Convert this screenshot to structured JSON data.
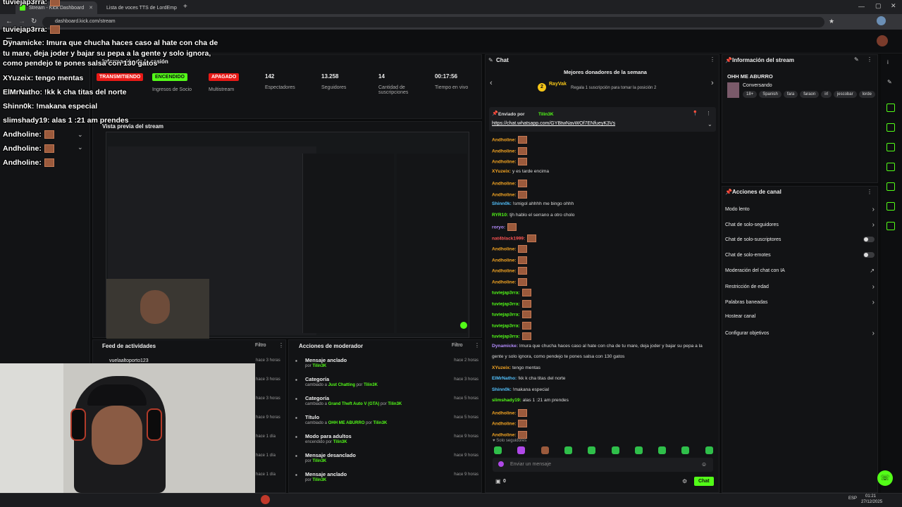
{
  "browser": {
    "tabs": [
      {
        "label": "Stream - Kick Dashboard"
      },
      {
        "label": "Lista de voces TTS de LordEmp"
      }
    ],
    "url": "dashboard.kick.com/stream"
  },
  "overlay": {
    "lines": [
      {
        "text": "tuviejap3rra:",
        "emote": true
      },
      {
        "text": "tuviejap3rra:",
        "emote": true
      },
      {
        "text": "Dynamicke: Imura que chucha haces caso al hate con cha de",
        "emote": false
      },
      {
        "text": "tu mare, deja joder y bajar su pepa a la gente y solo ignora,",
        "emote": false
      },
      {
        "text": "como pendejo te pones salsa con 130 gatos",
        "emote": false
      },
      {
        "text": "XYuzeix: tengo mentas",
        "emote": false
      },
      {
        "text": "ElMrNatho: !kk k cha titas del norte",
        "emote": false
      },
      {
        "text": "Shinn0k: !makana especial",
        "emote": false
      },
      {
        "text": "slimshady19: alas 1 :21 am prendes",
        "emote": false
      },
      {
        "text": "Andholine:",
        "emote": true
      },
      {
        "text": "Andholine:",
        "emote": true
      },
      {
        "text": "Andholine:",
        "emote": true
      }
    ]
  },
  "stream_info_header": "Información de la sesión",
  "stats": [
    {
      "badge": "TRANSMITIENDO",
      "label": "",
      "color": "#e91916"
    },
    {
      "badge": "ENCENDIDO",
      "label": "Ingresos de Socio",
      "color": "#53fc18"
    },
    {
      "badge": "APAGADO",
      "label": "Multistream",
      "color": "#e91916"
    },
    {
      "value": "142",
      "label": "Espectadores"
    },
    {
      "value": "13.258",
      "label": "Seguidores"
    },
    {
      "value": "14",
      "label": "Cantidad de suscripciones"
    },
    {
      "value": "00:17:56",
      "label": "Tiempo en vivo"
    }
  ],
  "preview_title": "Vista previa del stream",
  "activity": {
    "title": "Feed de actividades",
    "filter": "Filtro",
    "items": [
      {
        "user": "vuelaaltoporto123",
        "time": "hace 3 horas"
      },
      {
        "user": "",
        "time": "hace 3 horas"
      },
      {
        "user": "",
        "time": "hace 3 horas"
      },
      {
        "user": "",
        "time": "hace 9 horas"
      },
      {
        "user": "",
        "time": "hace 1 día"
      },
      {
        "user": "",
        "time": "hace 1 día"
      },
      {
        "user": "",
        "time": "hace 1 día"
      }
    ]
  },
  "moderator": {
    "title": "Acciones de moderador",
    "filter": "Filtro",
    "items": [
      {
        "title": "Mensaje anclado",
        "pre": "por",
        "hl": "Tilin3K",
        "mid": "",
        "by": "",
        "time": "hace 2 horas",
        "icon": "pin-icon"
      },
      {
        "title": "Categoría",
        "pre": "cambiado a",
        "hl": "Just Chatting",
        "mid": "por",
        "by": "Tilin3K",
        "time": "hace 3 horas",
        "icon": "category-icon"
      },
      {
        "title": "Categoría",
        "pre": "cambiado a",
        "hl": "Grand Theft Auto V (GTA)",
        "mid": "por",
        "by": "Tilin3K",
        "time": "hace 5 horas",
        "icon": "category-icon"
      },
      {
        "title": "Título",
        "pre": "cambiado a",
        "hl": "OHH ME ABURRO",
        "mid": "por",
        "by": "Tilin3K",
        "time": "hace 5 horas",
        "icon": "title-icon"
      },
      {
        "title": "Modo para adultos",
        "pre": "encendido por",
        "hl": "Tilin3K",
        "mid": "",
        "by": "",
        "time": "hace 9 horas",
        "icon": "adult-icon"
      },
      {
        "title": "Mensaje desanclado",
        "pre": "por",
        "hl": "Tilin3K",
        "mid": "",
        "by": "",
        "time": "hace 9 horas",
        "icon": "unpin-icon"
      },
      {
        "title": "Mensaje anclado",
        "pre": "por",
        "hl": "Tilin3K",
        "mid": "",
        "by": "",
        "time": "hace 9 horas",
        "icon": "pin-icon"
      }
    ]
  },
  "chat": {
    "title": "Chat",
    "donors_title": "Mejores donadores de la semana",
    "top_donor": "RayVak",
    "top_donor_rank": "2",
    "donor_cta": "Regala 1 suscripción para tomar la posición 2",
    "pinned_by_label": "Enviado por",
    "pinned_by": "Tilin3K",
    "pinned_link": "https://chat.whatsapp.com/GYBtwNavWOf7ENfueyK3Vs",
    "messages": [
      {
        "user": "Andholine:",
        "text": "",
        "emote": true,
        "color": "#f5a623"
      },
      {
        "user": "Andholine:",
        "text": "",
        "emote": true,
        "color": "#f5a623"
      },
      {
        "user": "Andholine:",
        "text": "",
        "emote": true,
        "color": "#f5a623"
      },
      {
        "user": "XYuzeix:",
        "text": "y es tarde encima",
        "emote": false,
        "color": "#f5a623"
      },
      {
        "user": "Andholine:",
        "text": "",
        "emote": true,
        "color": "#f5a623"
      },
      {
        "user": "Andholine:",
        "text": "",
        "emote": true,
        "color": "#f5a623"
      },
      {
        "user": "Shinn0k:",
        "text": "!smigol ahhhh me bingo ohhh",
        "emote": false,
        "color": "#53c1fc"
      },
      {
        "user": "RYR10:",
        "text": "tjh hablo el serrano a otro cholo",
        "emote": false,
        "color": "#53fc18"
      },
      {
        "user": "roryo:",
        "text": "",
        "emote": true,
        "color": "#b48cfc"
      },
      {
        "user": "nat4black1999:",
        "text": "",
        "emote": true,
        "color": "#fc5353"
      },
      {
        "user": "Andholine:",
        "text": "",
        "emote": true,
        "color": "#f5a623"
      },
      {
        "user": "Andholine:",
        "text": "",
        "emote": true,
        "color": "#f5a623"
      },
      {
        "user": "Andholine:",
        "text": "",
        "emote": true,
        "color": "#f5a623"
      },
      {
        "user": "Andholine:",
        "text": "",
        "emote": true,
        "color": "#f5a623"
      },
      {
        "user": "tuviejap3rra:",
        "text": "",
        "emote": true,
        "color": "#53fc18"
      },
      {
        "user": "tuviejap3rra:",
        "text": "",
        "emote": true,
        "color": "#53fc18"
      },
      {
        "user": "tuviejap3rra:",
        "text": "",
        "emote": true,
        "color": "#53fc18"
      },
      {
        "user": "tuviejap3rra:",
        "text": "",
        "emote": true,
        "color": "#53fc18"
      },
      {
        "user": "tuviejap3rra:",
        "text": "",
        "emote": true,
        "color": "#53fc18"
      },
      {
        "user": "Dynamicke:",
        "text": "Imura que chucha haces caso al hate con cha de tu mare, deja joder y bajar su pepa a la",
        "emote": false,
        "color": "#b48cfc"
      },
      {
        "user": "",
        "text": "gente y solo ignora, como pendejo te pones salsa con 130 gatos",
        "emote": false,
        "color": "#b48cfc"
      },
      {
        "user": "XYuzeix:",
        "text": "tengo mentas",
        "emote": false,
        "color": "#f5a623"
      },
      {
        "user": "ElMrNatho:",
        "text": "!kk k cha titas del norte",
        "emote": false,
        "color": "#53c1fc"
      },
      {
        "user": "Shinn0k:",
        "text": "!makana especial",
        "emote": false,
        "color": "#53c1fc"
      },
      {
        "user": "slimshady19:",
        "text": "alas 1 :21 am prendes",
        "emote": false,
        "color": "#53fc18"
      },
      {
        "user": "Andholine:",
        "text": "",
        "emote": true,
        "color": "#f5a623"
      },
      {
        "user": "Andholine:",
        "text": "",
        "emote": true,
        "color": "#f5a623"
      },
      {
        "user": "Andholine:",
        "text": "",
        "emote": true,
        "color": "#f5a623"
      }
    ],
    "followers_only": "Solo seguidores",
    "input_placeholder": "Enviar un mensaje",
    "count": "0",
    "send_label": "Chat"
  },
  "stream_info": {
    "title": "Información del stream",
    "stream_title": "OHH ME ABURRO",
    "category": "Conversando",
    "tags": [
      "18+",
      "Spanish",
      "fara",
      "faraon",
      "irl",
      "jescobar",
      "lorde"
    ]
  },
  "channel_actions": {
    "title": "Acciones de canal",
    "items": [
      {
        "label": "Modo lento",
        "control": "chevron"
      },
      {
        "label": "Chat de solo-seguidores",
        "control": "chevron"
      },
      {
        "label": "Chat de solo-suscriptores",
        "control": "toggle"
      },
      {
        "label": "Chat de solo-emotes",
        "control": "toggle"
      },
      {
        "label": "Moderación del chat con IA",
        "control": "external"
      },
      {
        "label": "Restricción de edad",
        "control": "chevron"
      },
      {
        "label": "Palabras baneadas",
        "control": "chevron"
      },
      {
        "label": "Hostear canal",
        "control": "none"
      },
      {
        "label": "Configurar objetivos",
        "control": "chevron"
      }
    ]
  },
  "taskbar": {
    "lang": "ESP",
    "time": "01:21",
    "date": "27/12/2025"
  },
  "colors": {
    "kick_green": "#53fc18",
    "live_red": "#e91916",
    "bg": "#0b0c0d",
    "panel": "#121315"
  }
}
